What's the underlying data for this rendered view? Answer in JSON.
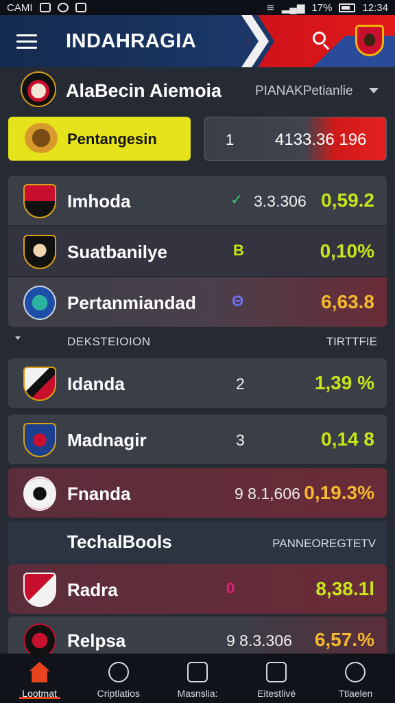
{
  "status_bar": {
    "carrier": "CAMI",
    "battery": "17%",
    "time": "12:34"
  },
  "app_bar": {
    "title": "INDAHRAGIA"
  },
  "league": {
    "name": "AlaBecin Aiemoia",
    "filter": "PIANAKPetianlie"
  },
  "highlight": {
    "label": "Pentangesin",
    "number": "1",
    "value": "4133.36 196"
  },
  "rows_top": [
    {
      "name": "Imhoda",
      "mark": "✓",
      "mid": "3.3.306",
      "pct": "0,59.2",
      "pct_color": "#c8e61a"
    },
    {
      "name": "Suatbanilye",
      "mark": "B",
      "mid": "",
      "pct": "0,10%",
      "pct_color": "#c8e61a"
    },
    {
      "name": "Pertanmiandad",
      "mark": "Θ",
      "mid": "",
      "pct": "6,63.8",
      "pct_color": "#f5b82e"
    }
  ],
  "section": {
    "title": "DEKSTEIOION",
    "right": "TIRTTFIE"
  },
  "rows_mid": [
    {
      "name": "Idanda",
      "mid": "2",
      "pct": "1,39 %",
      "pct_color": "#c8e61a"
    },
    {
      "name": "Madnagir",
      "mid": "3",
      "pct": "0,14 8",
      "pct_color": "#c8e61a"
    },
    {
      "name": "Fnanda",
      "mid": "9  8.1,606",
      "pct": "0,19.3%",
      "pct_color": "#f5b82e"
    }
  ],
  "group_banner": {
    "title": "TechalBools",
    "right": "PANNEOREGTETV"
  },
  "rows_bottom": [
    {
      "name": "Radra",
      "mark": "0",
      "pct": "8,38.1l",
      "pct_color": "#c8e61a"
    },
    {
      "name": "Relpsa",
      "mid": "9  8.3.306",
      "pct": "6,57.%",
      "pct_color": "#f5b82e"
    }
  ],
  "nav": [
    {
      "label": "Lootmat",
      "icon": "home-icon"
    },
    {
      "label": "Criptlatios",
      "icon": "shield-icon"
    },
    {
      "label": "Masnslia:",
      "icon": "document-icon"
    },
    {
      "label": "Eitestlivé",
      "icon": "chart-icon"
    },
    {
      "label": "Ttlaelen",
      "icon": "settings-icon"
    }
  ]
}
